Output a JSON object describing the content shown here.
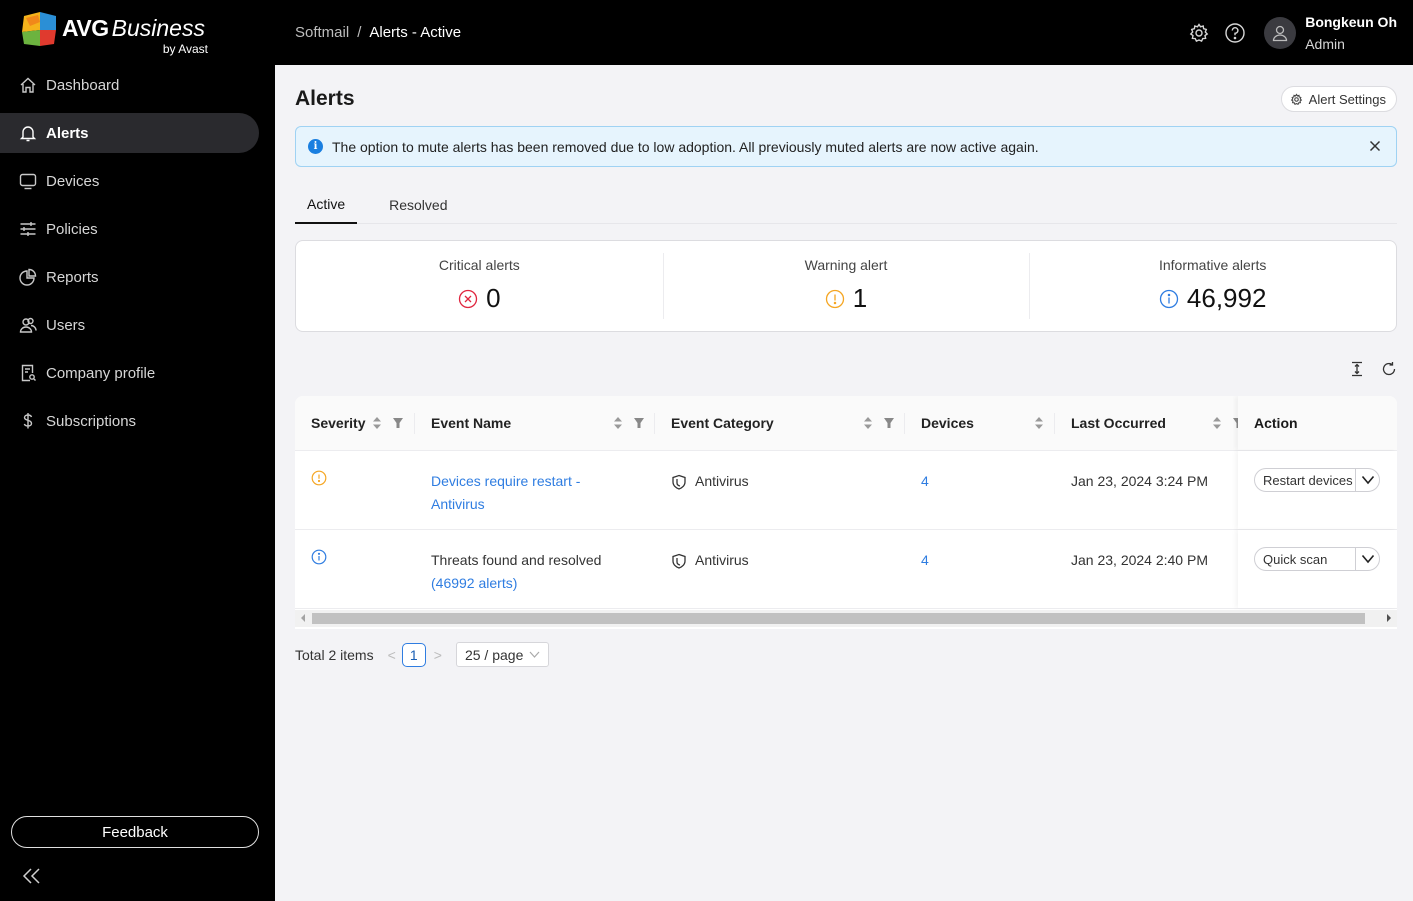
{
  "brand": {
    "name_bold": "AVG",
    "name_italic": "Business",
    "by": "by Avast"
  },
  "sidebar": {
    "items": [
      {
        "label": "Dashboard",
        "icon": "home-icon",
        "active": false
      },
      {
        "label": "Alerts",
        "icon": "bell-icon",
        "active": true
      },
      {
        "label": "Devices",
        "icon": "monitor-icon",
        "active": false
      },
      {
        "label": "Policies",
        "icon": "sliders-icon",
        "active": false
      },
      {
        "label": "Reports",
        "icon": "pie-chart-icon",
        "active": false
      },
      {
        "label": "Users",
        "icon": "users-icon",
        "active": false
      },
      {
        "label": "Company profile",
        "icon": "document-search-icon",
        "active": false
      },
      {
        "label": "Subscriptions",
        "icon": "dollar-icon",
        "active": false
      }
    ],
    "feedback_label": "Feedback",
    "collapse_icon": "double-chevron-left-icon"
  },
  "topbar": {
    "breadcrumb": {
      "parent": "Softmail",
      "separator": "/",
      "current": "Alerts - Active"
    },
    "user": {
      "name": "Bongkeun Oh",
      "role": "Admin"
    },
    "icons": [
      "gear-icon",
      "help-icon",
      "avatar-icon"
    ]
  },
  "page": {
    "title": "Alerts",
    "alert_settings_label": "Alert Settings",
    "banner": "The option to mute alerts has been removed due to low adoption. All previously muted alerts are now active again.",
    "tabs": [
      {
        "label": "Active",
        "active": true
      },
      {
        "label": "Resolved",
        "active": false
      }
    ],
    "stats": [
      {
        "label": "Critical alerts",
        "value": "0",
        "color": "#e0263f"
      },
      {
        "label": "Warning alert",
        "value": "1",
        "color": "#f5a623"
      },
      {
        "label": "Informative alerts",
        "value": "46,992",
        "color": "#2f7de1"
      }
    ]
  },
  "table": {
    "columns": [
      "Severity",
      "Event Name",
      "Event Category",
      "Devices",
      "Last Occurred",
      "Action"
    ],
    "rows": [
      {
        "severity": "warning",
        "event_name_line1": "Devices require restart -",
        "event_name_line2": "Antivirus",
        "category": "Antivirus",
        "devices": "4",
        "last_occurred": "Jan 23, 2024 3:24 PM",
        "action": "Restart devices"
      },
      {
        "severity": "info",
        "event_name_line1": "Threats found and resolved",
        "event_name_line2": "(46992 alerts)",
        "category": "Antivirus",
        "devices": "4",
        "last_occurred": "Jan 23, 2024 2:40 PM",
        "action": "Quick scan"
      }
    ]
  },
  "pagination": {
    "total": "Total 2 items",
    "current_page": "1",
    "page_size": "25 / page"
  }
}
